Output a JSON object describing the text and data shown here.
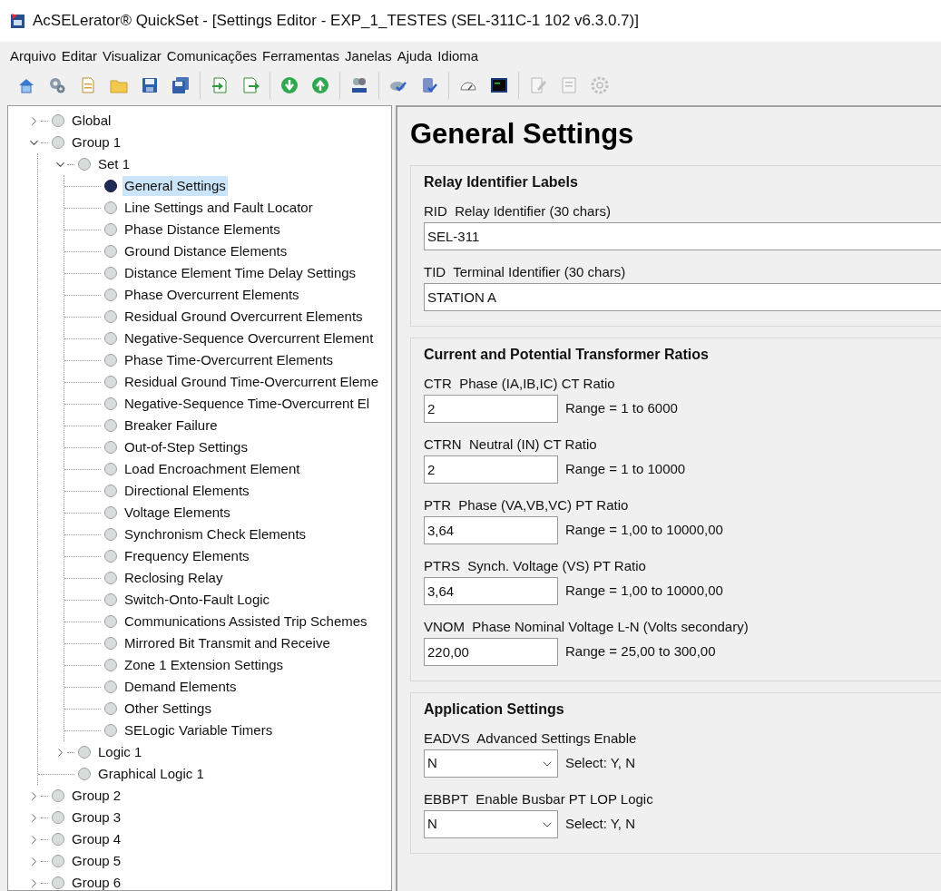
{
  "window": {
    "title": "AcSELerator® QuickSet - [Settings Editor - EXP_1_TESTES (SEL-311C-1 102 v6.3.0.7)]"
  },
  "menu": [
    "Arquivo",
    "Editar",
    "Visualizar",
    "Comunicações",
    "Ferramentas",
    "Janelas",
    "Ajuda",
    "Idioma"
  ],
  "toolbar": [
    [
      {
        "kind": "home",
        "disabled": false
      },
      {
        "kind": "gears",
        "disabled": false
      },
      {
        "kind": "new",
        "disabled": false
      },
      {
        "kind": "folder",
        "disabled": false
      },
      {
        "kind": "save",
        "disabled": false
      },
      {
        "kind": "saveall",
        "disabled": false
      }
    ],
    [
      {
        "kind": "import",
        "disabled": false
      },
      {
        "kind": "export",
        "disabled": false
      }
    ],
    [
      {
        "kind": "down",
        "disabled": false
      },
      {
        "kind": "up",
        "disabled": false
      }
    ],
    [
      {
        "kind": "spell",
        "disabled": false
      }
    ],
    [
      {
        "kind": "connect",
        "disabled": false
      },
      {
        "kind": "dbcheck",
        "disabled": false
      }
    ],
    [
      {
        "kind": "gauge",
        "disabled": false
      },
      {
        "kind": "terminal",
        "disabled": false
      }
    ],
    [
      {
        "kind": "editdoc",
        "disabled": true
      },
      {
        "kind": "doc",
        "disabled": true
      },
      {
        "kind": "gear",
        "disabled": true
      }
    ]
  ],
  "tree": [
    {
      "label": "Global",
      "expanded": false,
      "selected": false
    },
    {
      "label": "Group 1",
      "expanded": true,
      "selected": false,
      "children": [
        {
          "label": "Set 1",
          "expanded": true,
          "selected": false,
          "children": [
            {
              "label": "General Settings",
              "selected": true
            },
            {
              "label": "Line Settings and Fault Locator",
              "selected": false
            },
            {
              "label": "Phase Distance Elements",
              "selected": false
            },
            {
              "label": "Ground Distance Elements",
              "selected": false
            },
            {
              "label": "Distance Element Time Delay Settings",
              "selected": false
            },
            {
              "label": "Phase Overcurrent Elements",
              "selected": false
            },
            {
              "label": "Residual Ground Overcurrent Elements",
              "selected": false
            },
            {
              "label": "Negative-Sequence Overcurrent Element",
              "selected": false
            },
            {
              "label": "Phase Time-Overcurrent Elements",
              "selected": false
            },
            {
              "label": "Residual Ground Time-Overcurrent Eleme",
              "selected": false
            },
            {
              "label": "Negative-Sequence Time-Overcurrent El",
              "selected": false
            },
            {
              "label": "Breaker Failure",
              "selected": false
            },
            {
              "label": "Out-of-Step Settings",
              "selected": false
            },
            {
              "label": "Load Encroachment Element",
              "selected": false
            },
            {
              "label": "Directional Elements",
              "selected": false
            },
            {
              "label": "Voltage Elements",
              "selected": false
            },
            {
              "label": "Synchronism Check Elements",
              "selected": false
            },
            {
              "label": "Frequency Elements",
              "selected": false
            },
            {
              "label": "Reclosing Relay",
              "selected": false
            },
            {
              "label": "Switch-Onto-Fault Logic",
              "selected": false
            },
            {
              "label": "Communications Assisted Trip Schemes",
              "selected": false
            },
            {
              "label": "Mirrored Bit Transmit and Receive",
              "selected": false
            },
            {
              "label": "Zone 1 Extension Settings",
              "selected": false
            },
            {
              "label": "Demand Elements",
              "selected": false
            },
            {
              "label": "Other Settings",
              "selected": false
            },
            {
              "label": "SELogic Variable Timers",
              "selected": false
            }
          ]
        },
        {
          "label": "Logic 1",
          "expanded": false,
          "selected": false
        },
        {
          "label": "Graphical Logic 1",
          "selected": false
        }
      ]
    },
    {
      "label": "Group 2",
      "expanded": false,
      "selected": false
    },
    {
      "label": "Group 3",
      "expanded": false,
      "selected": false
    },
    {
      "label": "Group 4",
      "expanded": false,
      "selected": false
    },
    {
      "label": "Group 5",
      "expanded": false,
      "selected": false
    },
    {
      "label": "Group 6",
      "expanded": false,
      "selected": false
    }
  ],
  "editor": {
    "title": "General Settings",
    "sections": [
      {
        "title": "Relay Identifier Labels",
        "fields": [
          {
            "kind": "text",
            "label": "RID  Relay Identifier (30 chars)",
            "value": "SEL-311"
          },
          {
            "kind": "text",
            "label": "TID  Terminal Identifier (30 chars)",
            "value": "STATION A"
          }
        ]
      },
      {
        "title": "Current and Potential Transformer Ratios",
        "fields": [
          {
            "kind": "number",
            "label": "CTR  Phase (IA,IB,IC) CT Ratio",
            "value": "2",
            "hint": "Range = 1 to 6000"
          },
          {
            "kind": "number",
            "label": "CTRN  Neutral (IN) CT Ratio",
            "value": "2",
            "hint": "Range = 1 to 10000"
          },
          {
            "kind": "number",
            "label": "PTR  Phase (VA,VB,VC) PT Ratio",
            "value": "3,64",
            "hint": "Range = 1,00 to 10000,00"
          },
          {
            "kind": "number",
            "label": "PTRS  Synch. Voltage (VS) PT Ratio",
            "value": "3,64",
            "hint": "Range = 1,00 to 10000,00"
          },
          {
            "kind": "number",
            "label": "VNOM  Phase Nominal Voltage L-N (Volts secondary)",
            "value": "220,00",
            "hint": "Range = 25,00 to 300,00"
          }
        ]
      },
      {
        "title": "Application Settings",
        "fields": [
          {
            "kind": "select",
            "label": "EADVS  Advanced Settings Enable",
            "value": "N",
            "hint": "Select: Y, N"
          },
          {
            "kind": "select",
            "label": "EBBPT  Enable Busbar PT LOP Logic",
            "value": "N",
            "hint": "Select: Y, N"
          }
        ]
      }
    ]
  }
}
